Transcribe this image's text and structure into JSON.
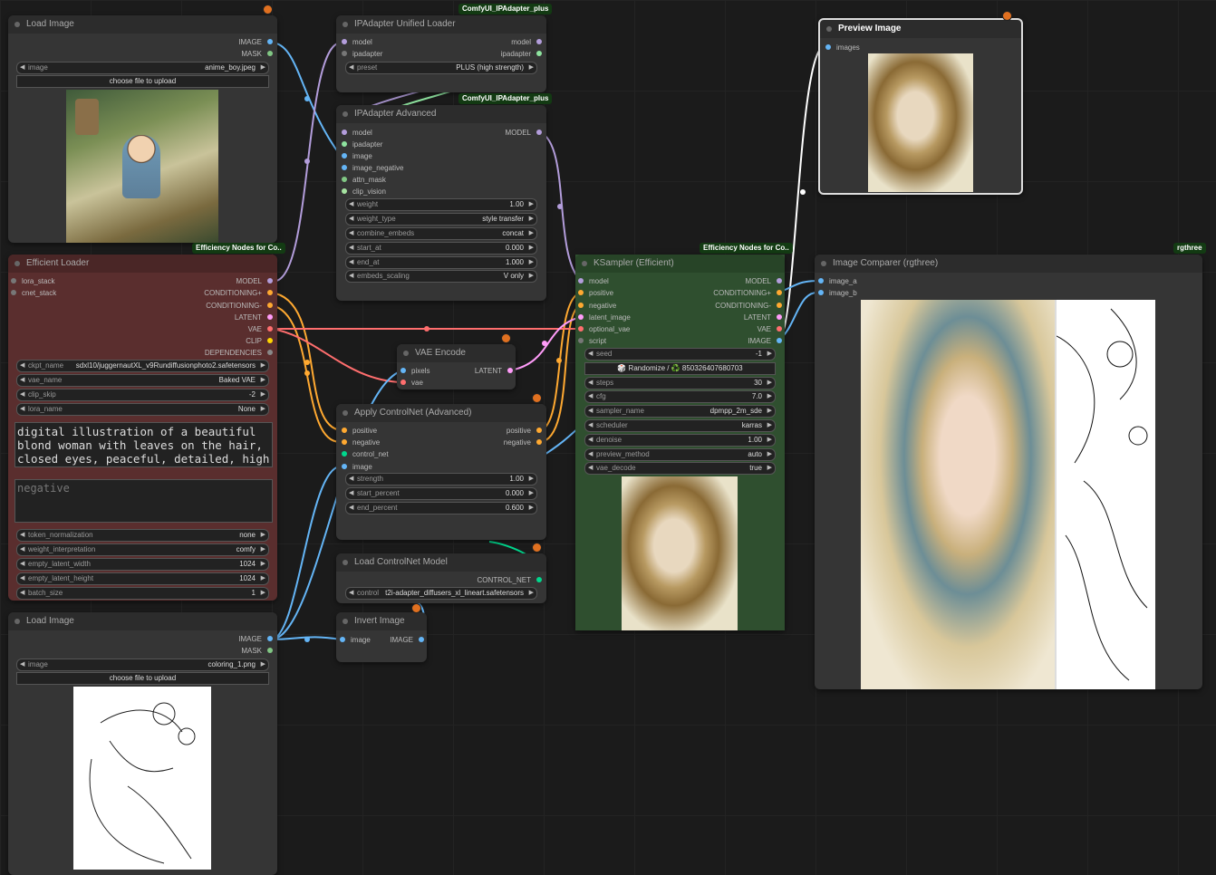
{
  "colors": {
    "model": "#b39ddb",
    "ipadapter": "#8ee39f",
    "image": "#64b5f6",
    "mask": "#81c784",
    "conditioning": "#ffa931",
    "vae": "#ff6e6e",
    "latent": "#ff9cf9",
    "clip": "#ffd500",
    "control_net": "#00d78d"
  },
  "load_image_1": {
    "title": "Load Image",
    "out_image": "IMAGE",
    "out_mask": "MASK",
    "image_label": "image",
    "image_value": "anime_boy.jpeg",
    "upload": "choose file to upload"
  },
  "ipa_loader": {
    "badge": "ComfyUI_IPAdapter_plus",
    "title": "IPAdapter Unified Loader",
    "in_model": "model",
    "in_ipadapter": "ipadapter",
    "out_model": "model",
    "out_ipadapter": "ipadapter",
    "preset_label": "preset",
    "preset_value": "PLUS (high strength)"
  },
  "ipa_adv": {
    "badge": "ComfyUI_IPAdapter_plus",
    "title": "IPAdapter Advanced",
    "inputs": [
      "model",
      "ipadapter",
      "image",
      "image_negative",
      "attn_mask",
      "clip_vision"
    ],
    "out_model": "MODEL",
    "widgets": [
      {
        "label": "weight",
        "value": "1.00"
      },
      {
        "label": "weight_type",
        "value": "style transfer"
      },
      {
        "label": "combine_embeds",
        "value": "concat"
      },
      {
        "label": "start_at",
        "value": "0.000"
      },
      {
        "label": "end_at",
        "value": "1.000"
      },
      {
        "label": "embeds_scaling",
        "value": "V only"
      }
    ]
  },
  "preview": {
    "title": "Preview Image",
    "in_images": "images"
  },
  "eff_loader": {
    "badge": "Efficiency Nodes for Co..",
    "title": "Efficient Loader",
    "in_lora": "lora_stack",
    "in_cnet": "cnet_stack",
    "outputs": [
      "MODEL",
      "CONDITIONING+",
      "CONDITIONING-",
      "LATENT",
      "VAE",
      "CLIP",
      "DEPENDENCIES"
    ],
    "widgets": [
      {
        "label": "ckpt_name",
        "value": "sdxl10/juggernautXL_v9Rundiffusionphoto2.safetensors"
      },
      {
        "label": "vae_name",
        "value": "Baked VAE"
      },
      {
        "label": "clip_skip",
        "value": "-2"
      },
      {
        "label": "lora_name",
        "value": "None"
      }
    ],
    "positive": "digital illustration of a beautiful blond woman with leaves on the hair, closed eyes, peaceful, detailed, high",
    "negative": "negative",
    "widgets2": [
      {
        "label": "token_normalization",
        "value": "none"
      },
      {
        "label": "weight_interpretation",
        "value": "comfy"
      },
      {
        "label": "empty_latent_width",
        "value": "1024"
      },
      {
        "label": "empty_latent_height",
        "value": "1024"
      },
      {
        "label": "batch_size",
        "value": "1"
      }
    ]
  },
  "vae_encode": {
    "title": "VAE Encode",
    "in_pixels": "pixels",
    "in_vae": "vae",
    "out_latent": "LATENT"
  },
  "apply_cn": {
    "title": "Apply ControlNet (Advanced)",
    "inputs": [
      "positive",
      "negative",
      "control_net",
      "image"
    ],
    "out_positive": "positive",
    "out_negative": "negative",
    "widgets": [
      {
        "label": "strength",
        "value": "1.00"
      },
      {
        "label": "start_percent",
        "value": "0.000"
      },
      {
        "label": "end_percent",
        "value": "0.600"
      }
    ]
  },
  "load_cn": {
    "title": "Load ControlNet Model",
    "out": "CONTROL_NET",
    "widget_label": "control",
    "widget_value": "t2i-adapter_diffusers_xl_lineart.safetensors"
  },
  "ksampler": {
    "badge": "Efficiency Nodes for Co..",
    "title": "KSampler (Efficient)",
    "inputs": [
      "model",
      "positive",
      "negative",
      "latent_image",
      "optional_vae",
      "script"
    ],
    "outputs": [
      "MODEL",
      "CONDITIONING+",
      "CONDITIONING-",
      "LATENT",
      "VAE",
      "IMAGE"
    ],
    "seed_label": "seed",
    "seed_value": "-1",
    "randomize": "🎲 Randomize / ♻️ 850326407680703",
    "widgets": [
      {
        "label": "steps",
        "value": "30"
      },
      {
        "label": "cfg",
        "value": "7.0"
      },
      {
        "label": "sampler_name",
        "value": "dpmpp_2m_sde"
      },
      {
        "label": "scheduler",
        "value": "karras"
      },
      {
        "label": "denoise",
        "value": "1.00"
      },
      {
        "label": "preview_method",
        "value": "auto"
      },
      {
        "label": "vae_decode",
        "value": "true"
      }
    ]
  },
  "comparer": {
    "badge": "rgthree",
    "title": "Image Comparer (rgthree)",
    "in_a": "image_a",
    "in_b": "image_b"
  },
  "load_image_2": {
    "title": "Load Image",
    "out_image": "IMAGE",
    "out_mask": "MASK",
    "image_label": "image",
    "image_value": "coloring_1.png",
    "upload": "choose file to upload"
  },
  "invert": {
    "title": "Invert Image",
    "in_image": "image",
    "out_image": "IMAGE"
  }
}
